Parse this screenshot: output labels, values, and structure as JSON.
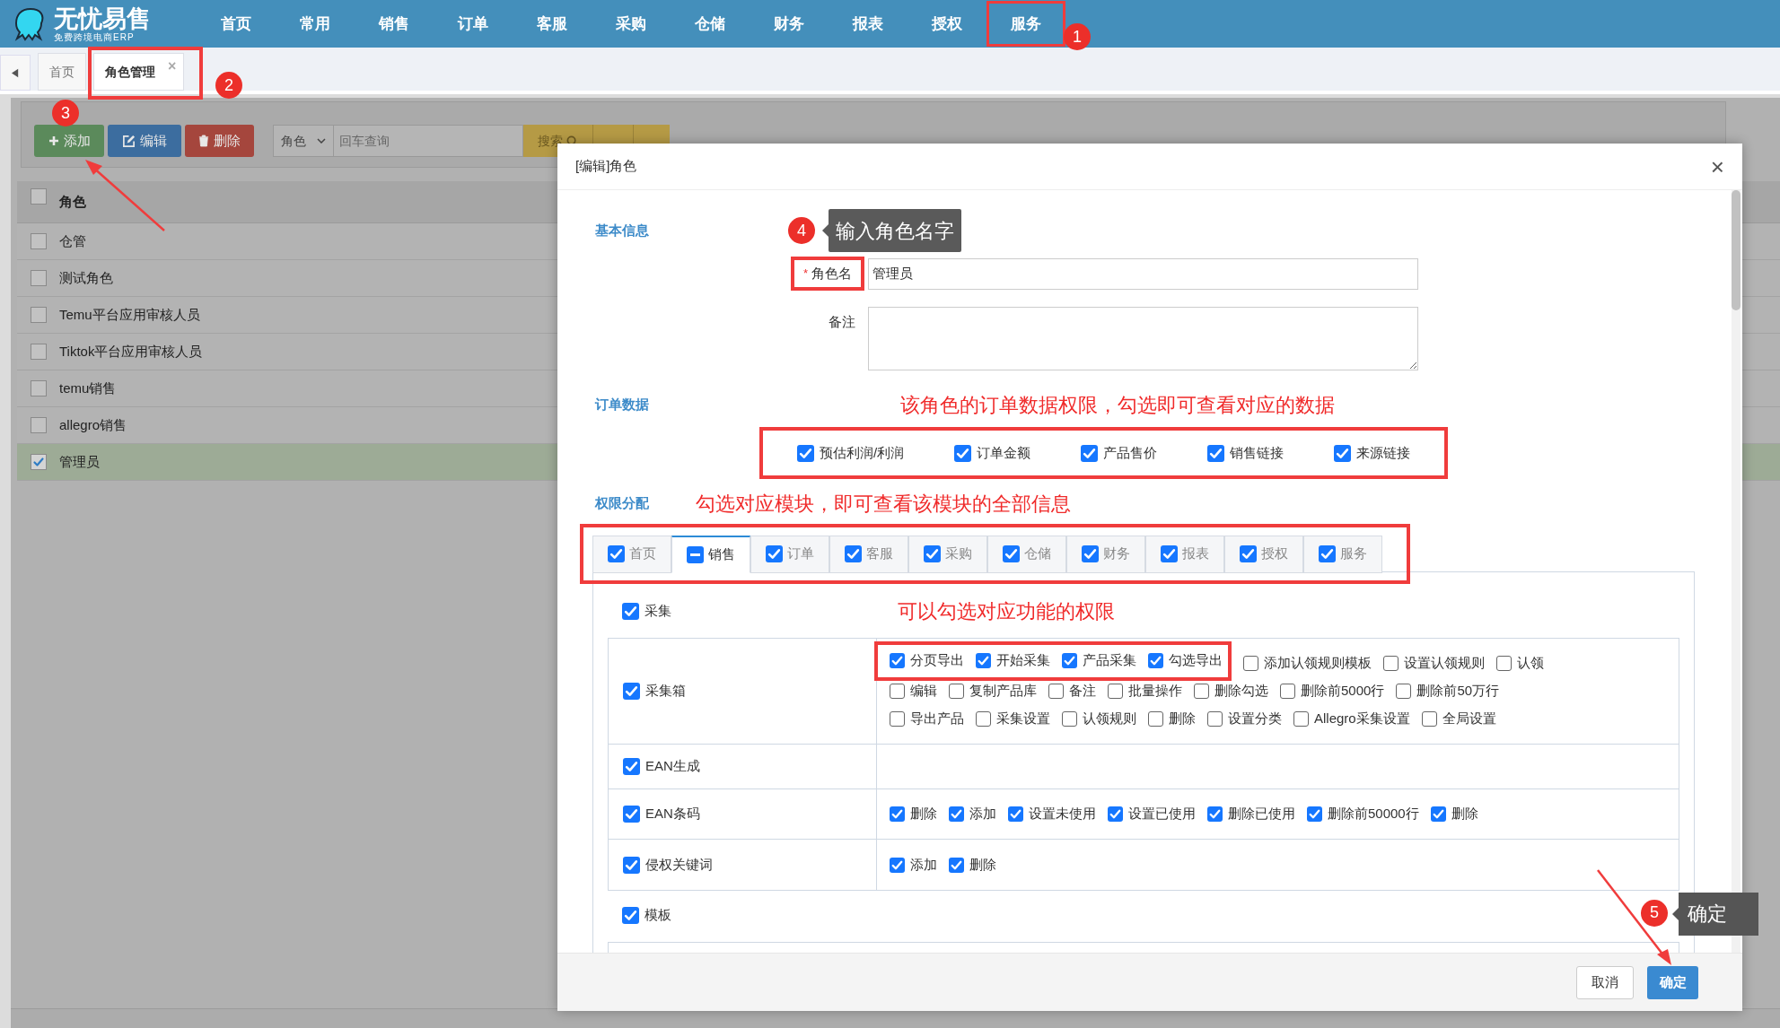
{
  "logo": {
    "title": "无忧易售",
    "subtitle": "免费跨境电商ERP"
  },
  "nav": [
    {
      "label": "首页",
      "highlight": false
    },
    {
      "label": "常用",
      "highlight": false
    },
    {
      "label": "销售",
      "highlight": false
    },
    {
      "label": "订单",
      "highlight": false
    },
    {
      "label": "客服",
      "highlight": false
    },
    {
      "label": "采购",
      "highlight": false
    },
    {
      "label": "仓储",
      "highlight": false
    },
    {
      "label": "财务",
      "highlight": false
    },
    {
      "label": "报表",
      "highlight": false
    },
    {
      "label": "授权",
      "highlight": false
    },
    {
      "label": "服务",
      "highlight": true,
      "badge": "1"
    }
  ],
  "page_tabs": [
    {
      "label": "首页",
      "selected": false,
      "highlight": false
    },
    {
      "label": "角色管理",
      "selected": true,
      "close": "×",
      "highlight": true,
      "badge": "2"
    }
  ],
  "toolbar": {
    "buttons": [
      {
        "kind": "add",
        "label": "添加",
        "badge": "3"
      },
      {
        "kind": "edit",
        "label": "编辑"
      },
      {
        "kind": "delete",
        "label": "删除"
      }
    ],
    "search": {
      "field": "角色",
      "placeholder": "回车查询",
      "button": "搜索"
    }
  },
  "role_table": {
    "column": "角色",
    "header_checked": false,
    "rows": [
      {
        "label": "仓管",
        "checked": false,
        "selected": false
      },
      {
        "label": "测试角色",
        "checked": false,
        "selected": false
      },
      {
        "label": "Temu平台应用审核人员",
        "checked": false,
        "selected": false
      },
      {
        "label": "Tiktok平台应用审核人员",
        "checked": false,
        "selected": false
      },
      {
        "label": "temu销售",
        "checked": false,
        "selected": false
      },
      {
        "label": "allegro销售",
        "checked": false,
        "selected": false
      },
      {
        "label": "管理员",
        "checked": true,
        "selected": true
      }
    ]
  },
  "dialog": {
    "title": "[编辑]角色",
    "close": "×",
    "basic": {
      "label": "基本信息",
      "tooltip": "输入角色名字",
      "badge": "4",
      "name_field": {
        "label": "角色名",
        "required": "*",
        "value": "管理员",
        "highlight": true
      },
      "remark_field": {
        "label": "备注"
      }
    },
    "order_data": {
      "label": "订单数据",
      "note": "该角色的订单数据权限，勾选即可查看对应的数据",
      "highlight": true,
      "options": [
        {
          "label": "预估利润/利润",
          "checked": true
        },
        {
          "label": "订单金额",
          "checked": true
        },
        {
          "label": "产品售价",
          "checked": true
        },
        {
          "label": "销售链接",
          "checked": true
        },
        {
          "label": "来源链接",
          "checked": true
        }
      ]
    },
    "permissions": {
      "label": "权限分配",
      "note": "勾选对应模块，即可查看该模块的全部信息",
      "highlight": true,
      "tabs": [
        {
          "label": "首页",
          "checked": true,
          "partial": false,
          "selected": false
        },
        {
          "label": "销售",
          "checked": true,
          "partial": true,
          "selected": true
        },
        {
          "label": "订单",
          "checked": true,
          "partial": false,
          "selected": false
        },
        {
          "label": "客服",
          "checked": true,
          "partial": false,
          "selected": false
        },
        {
          "label": "采购",
          "checked": true,
          "partial": false,
          "selected": false
        },
        {
          "label": "仓储",
          "checked": true,
          "partial": false,
          "selected": false
        },
        {
          "label": "财务",
          "checked": true,
          "partial": false,
          "selected": false
        },
        {
          "label": "报表",
          "checked": true,
          "partial": false,
          "selected": false
        },
        {
          "label": "授权",
          "checked": true,
          "partial": false,
          "selected": false
        },
        {
          "label": "服务",
          "checked": true,
          "partial": false,
          "selected": false
        }
      ],
      "groups": [
        {
          "label": "采集",
          "checked": true,
          "note": "可以勾选对应功能的权限",
          "rows": [
            {
              "label": "采集箱",
              "checked": true,
              "option_lines": [
                [
                  {
                    "label": "分页导出",
                    "checked": true,
                    "highlight": true
                  },
                  {
                    "label": "开始采集",
                    "checked": true,
                    "highlight": true
                  },
                  {
                    "label": "产品采集",
                    "checked": true,
                    "highlight": true
                  },
                  {
                    "label": "勾选导出",
                    "checked": true,
                    "highlight": true
                  },
                  {
                    "label": "添加认领规则模板",
                    "checked": false,
                    "highlight": false
                  },
                  {
                    "label": "设置认领规则",
                    "checked": false,
                    "highlight": false
                  },
                  {
                    "label": "认领",
                    "checked": false,
                    "highlight": false
                  }
                ],
                [
                  {
                    "label": "编辑",
                    "checked": false,
                    "highlight": false
                  },
                  {
                    "label": "复制产品库",
                    "checked": false,
                    "highlight": false
                  },
                  {
                    "label": "备注",
                    "checked": false,
                    "highlight": false
                  },
                  {
                    "label": "批量操作",
                    "checked": false,
                    "highlight": false
                  },
                  {
                    "label": "删除勾选",
                    "checked": false,
                    "highlight": false
                  },
                  {
                    "label": "删除前5000行",
                    "checked": false,
                    "highlight": false
                  },
                  {
                    "label": "删除前50万行",
                    "checked": false,
                    "highlight": false
                  }
                ],
                [
                  {
                    "label": "导出产品",
                    "checked": false,
                    "highlight": false
                  },
                  {
                    "label": "采集设置",
                    "checked": false,
                    "highlight": false
                  },
                  {
                    "label": "认领规则",
                    "checked": false,
                    "highlight": false
                  },
                  {
                    "label": "删除",
                    "checked": false,
                    "highlight": false
                  },
                  {
                    "label": "设置分类",
                    "checked": false,
                    "highlight": false
                  },
                  {
                    "label": "Allegro采集设置",
                    "checked": false,
                    "highlight": false
                  },
                  {
                    "label": "全局设置",
                    "checked": false,
                    "highlight": false
                  }
                ]
              ]
            },
            {
              "label": "EAN生成",
              "checked": true
            },
            {
              "label": "EAN条码",
              "checked": true,
              "option_lines": [
                [
                  {
                    "label": "删除",
                    "checked": true,
                    "highlight": false
                  },
                  {
                    "label": "添加",
                    "checked": true,
                    "highlight": false
                  },
                  {
                    "label": "设置未使用",
                    "checked": true,
                    "highlight": false
                  },
                  {
                    "label": "设置已使用",
                    "checked": true,
                    "highlight": false
                  },
                  {
                    "label": "删除已使用",
                    "checked": true,
                    "highlight": false
                  },
                  {
                    "label": "删除前50000行",
                    "checked": true,
                    "highlight": false
                  },
                  {
                    "label": "删除",
                    "checked": true,
                    "highlight": false
                  }
                ]
              ]
            },
            {
              "label": "侵权关键词",
              "checked": true,
              "option_lines": [
                [
                  {
                    "label": "添加",
                    "checked": true,
                    "highlight": false
                  },
                  {
                    "label": "删除",
                    "checked": true,
                    "highlight": false
                  }
                ]
              ]
            }
          ]
        },
        {
          "label": "模板",
          "checked": true
        }
      ]
    },
    "buttons": [
      {
        "kind": "cancel",
        "label": "取消"
      },
      {
        "kind": "confirm",
        "label": "确定",
        "tooltip": "确定",
        "badge": "5"
      }
    ]
  }
}
